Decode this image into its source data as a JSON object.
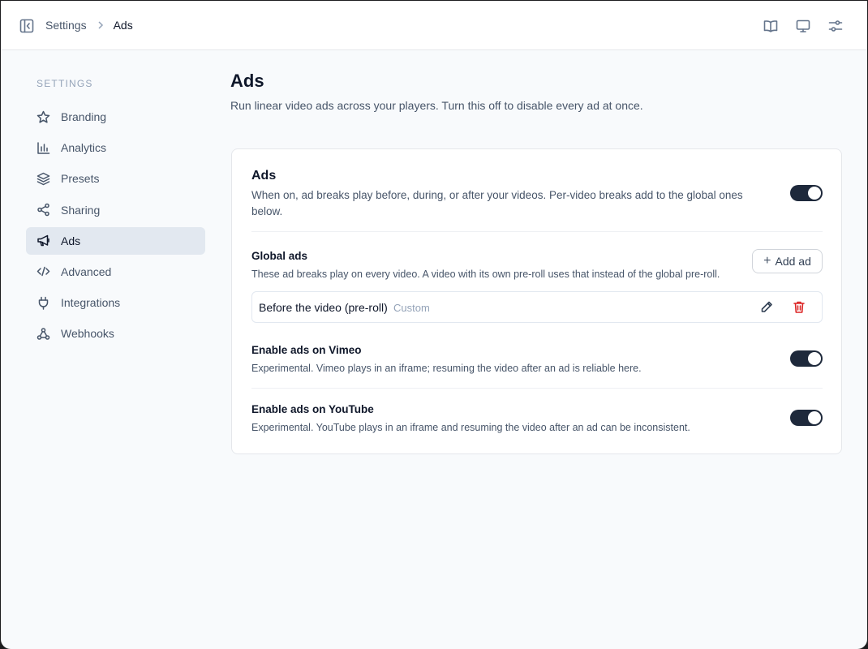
{
  "breadcrumb": {
    "parent": "Settings",
    "current": "Ads"
  },
  "topbar_icons": [
    "sidebar-toggle-icon",
    "book-icon",
    "monitor-icon",
    "sliders-icon"
  ],
  "sidebar": {
    "heading": "SETTINGS",
    "items": [
      {
        "label": "Branding",
        "icon": "star-icon",
        "active": false
      },
      {
        "label": "Analytics",
        "icon": "bar-chart-icon",
        "active": false
      },
      {
        "label": "Presets",
        "icon": "layers-icon",
        "active": false
      },
      {
        "label": "Sharing",
        "icon": "share-icon",
        "active": false
      },
      {
        "label": "Ads",
        "icon": "megaphone-icon",
        "active": true
      },
      {
        "label": "Advanced",
        "icon": "code-icon",
        "active": false
      },
      {
        "label": "Integrations",
        "icon": "plug-icon",
        "active": false
      },
      {
        "label": "Webhooks",
        "icon": "webhook-icon",
        "active": false
      }
    ]
  },
  "main": {
    "title": "Ads",
    "description": "Run linear video ads across your players. Turn this off to disable every ad at once.",
    "ads_section": {
      "title": "Ads",
      "description": "When on, ad breaks play before, during, or after your videos. Per-video breaks add to the global ones below.",
      "enabled": true
    },
    "global_ads": {
      "title": "Global ads",
      "description": "These ad breaks play on every video. A video with its own pre-roll uses that instead of the global pre-roll.",
      "add_label": "Add ad",
      "items": [
        {
          "name": "Before the video (pre-roll)",
          "tag": "Custom"
        }
      ]
    },
    "vimeo": {
      "title": "Enable ads on Vimeo",
      "description": "Experimental. Vimeo plays in an iframe; resuming the video after an ad is reliable here.",
      "enabled": true
    },
    "youtube": {
      "title": "Enable ads on YouTube",
      "description": "Experimental. YouTube plays in an iframe and resuming the video after an ad can be inconsistent.",
      "enabled": true
    }
  },
  "colors": {
    "accent": "#1e293b",
    "danger": "#dc2626",
    "active_nav_bg": "#e2e8f0"
  }
}
